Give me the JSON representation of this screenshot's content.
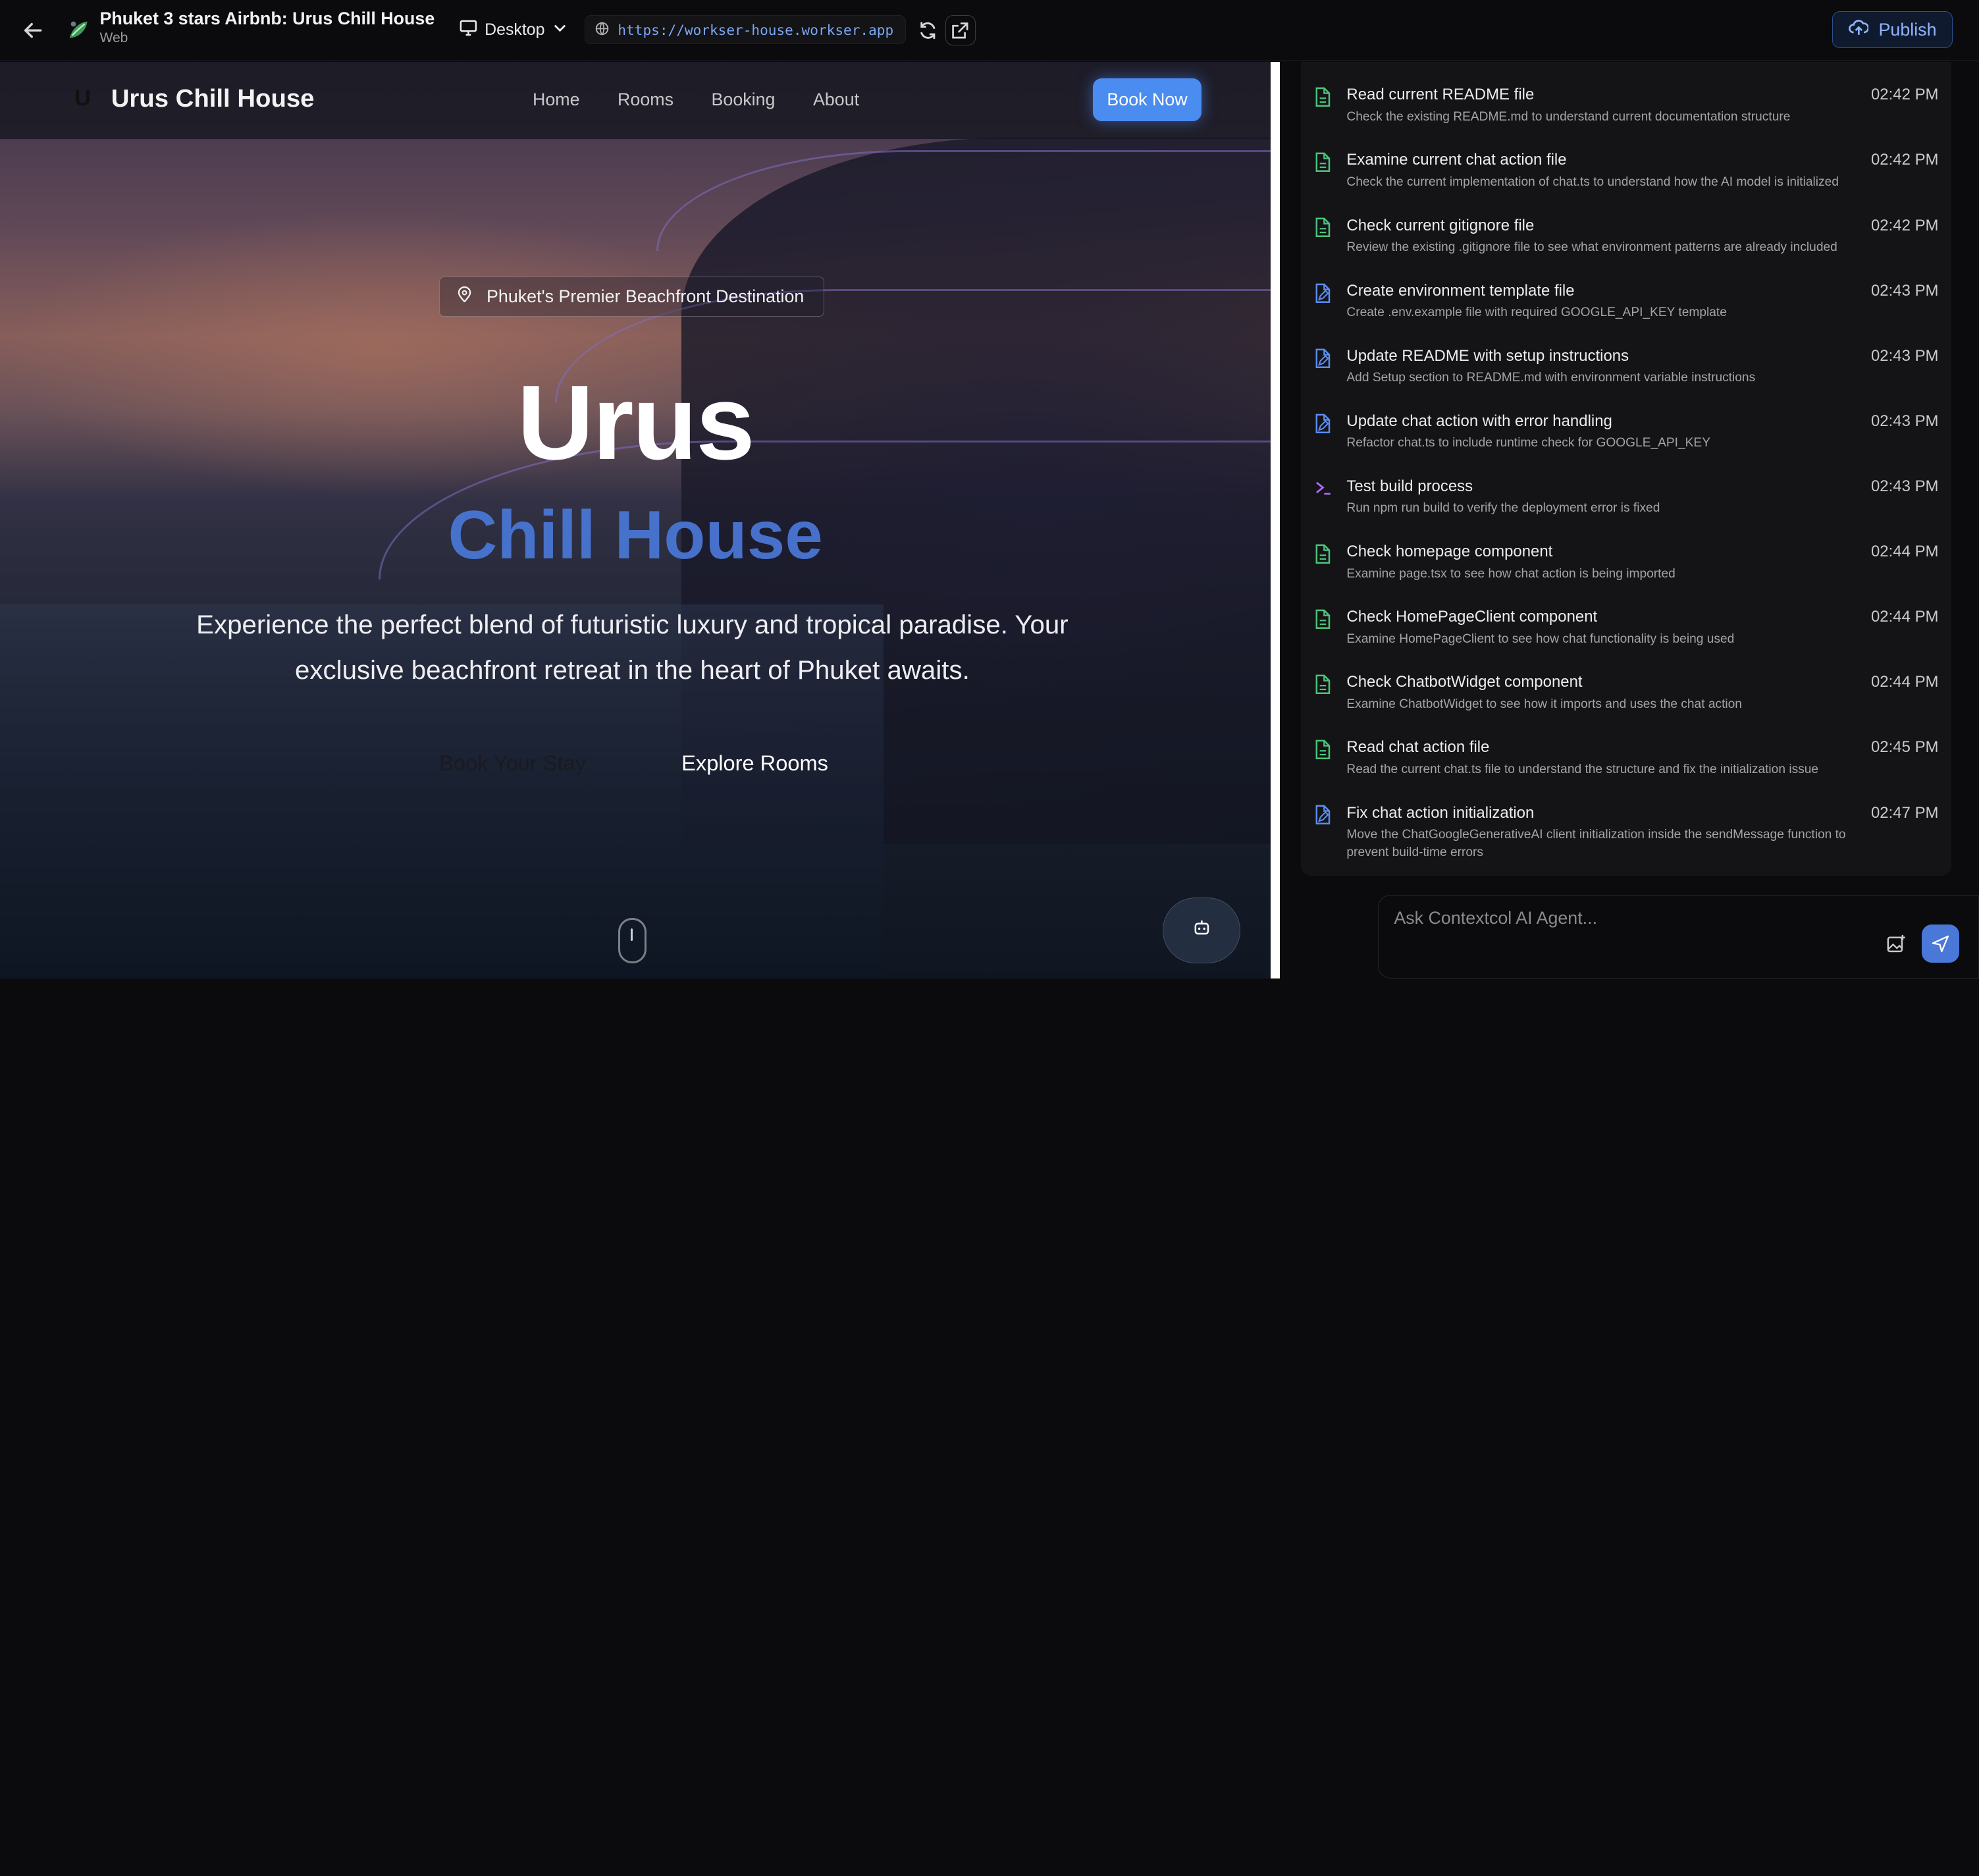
{
  "app": {
    "project_title": "Phuket 3 stars Airbnb: Urus Chill House",
    "project_subtitle": "Web",
    "device_label": "Desktop",
    "url": "https://workser-house.workser.app",
    "publish_label": "Publish"
  },
  "preview": {
    "logo_letter": "U",
    "brand": "Urus Chill House",
    "nav_links": [
      "Home",
      "Rooms",
      "Booking",
      "About"
    ],
    "book_now": "Book Now",
    "chip": "Phuket's Premier Beachfront Destination",
    "hero_line1": "Urus",
    "hero_line2": "Chill House",
    "hero_desc": "Experience the perfect blend of futuristic luxury and tropical paradise. Your exclusive beachfront retreat in the heart of Phuket awaits.",
    "cta_primary": "Book Your Stay",
    "cta_secondary": "Explore Rooms"
  },
  "log": [
    {
      "type": "read",
      "title": "Read current README file",
      "desc": "Check the existing README.md to understand current documentation structure",
      "time": "02:42 PM"
    },
    {
      "type": "read",
      "title": "Examine current chat action file",
      "desc": "Check the current implementation of chat.ts to understand how the AI model is initialized",
      "time": "02:42 PM"
    },
    {
      "type": "read",
      "title": "Check current gitignore file",
      "desc": "Review the existing .gitignore file to see what environment patterns are already included",
      "time": "02:42 PM"
    },
    {
      "type": "write",
      "title": "Create environment template file",
      "desc": "Create .env.example file with required GOOGLE_API_KEY template",
      "time": "02:43 PM"
    },
    {
      "type": "write",
      "title": "Update README with setup instructions",
      "desc": "Add Setup section to README.md with environment variable instructions",
      "time": "02:43 PM"
    },
    {
      "type": "write",
      "title": "Update chat action with error handling",
      "desc": "Refactor chat.ts to include runtime check for GOOGLE_API_KEY",
      "time": "02:43 PM"
    },
    {
      "type": "terminal",
      "title": "Test build process",
      "desc": "Run npm run build to verify the deployment error is fixed",
      "time": "02:43 PM"
    },
    {
      "type": "read",
      "title": "Check homepage component",
      "desc": "Examine page.tsx to see how chat action is being imported",
      "time": "02:44 PM"
    },
    {
      "type": "read",
      "title": "Check HomePageClient component",
      "desc": "Examine HomePageClient to see how chat functionality is being used",
      "time": "02:44 PM"
    },
    {
      "type": "read",
      "title": "Check ChatbotWidget component",
      "desc": "Examine ChatbotWidget to see how it imports and uses the chat action",
      "time": "02:44 PM"
    },
    {
      "type": "read",
      "title": "Read chat action file",
      "desc": "Read the current chat.ts file to understand the structure and fix the initialization issue",
      "time": "02:45 PM"
    },
    {
      "type": "write",
      "title": "Fix chat action initialization",
      "desc": "Move the ChatGoogleGenerativeAI client initialization inside the sendMessage function to prevent build-time errors",
      "time": "02:47 PM"
    }
  ],
  "composer": {
    "placeholder": "Ask Contextcol AI Agent..."
  },
  "colors": {
    "accent": "#4a8cf0",
    "read_icon": "#4cc37a",
    "write_icon": "#5b8def",
    "terminal_icon": "#a76bf0"
  },
  "icons": {
    "back": "arrow-left-icon",
    "project": "leaf-icon",
    "device": "monitor-icon",
    "globe": "globe-icon",
    "refresh": "refresh-icon",
    "open_external": "external-link-icon",
    "publish": "cloud-upload-icon",
    "location": "map-pin-icon",
    "bot": "bot-icon",
    "attach": "image-attach-icon",
    "send": "send-icon",
    "read": "file-icon",
    "write": "file-edit-icon",
    "terminal": "terminal-icon"
  }
}
